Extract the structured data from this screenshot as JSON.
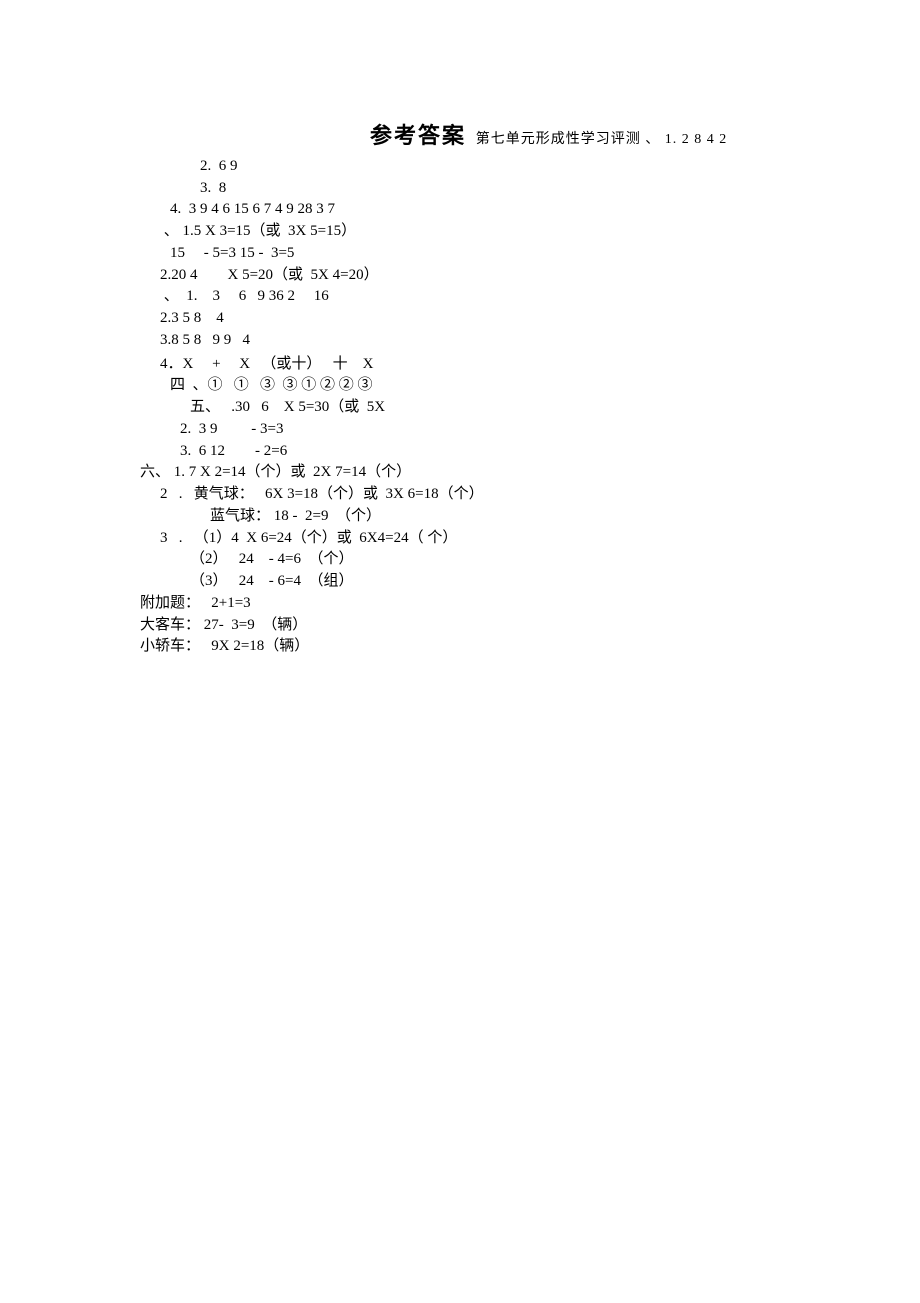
{
  "title": {
    "main": "参考答案",
    "sub": "第七单元形成性学习评测  、   1. 2 8 4 2"
  },
  "lines": {
    "l01": "2.  6 9",
    "l02": "3.  8",
    "l03": "4.  3 9 4 6 15 6 7 4 9 28 3 7",
    "l04": " 、 1.5 X 3=15（或  3X 5=15）",
    "l05": "15     - 5=3 15 -  3=5",
    "l06": "2.20 4        X 5=20（或  5X 4=20）",
    "l07": " 、  1.    3     6   9 36 2     16",
    "l08": "2.3 5 8    4",
    "l09": "3.8 5 8   9 9   4",
    "l10": "4．X     +     X   （或十）   十    X",
    "l11": "四  、①   ①   ③  ③ ① ② ② ③",
    "l12": "五、   .30   6    X 5=30（或  5X",
    "l13": "2.  3 9         - 3=3",
    "l14": "3.  6 12        - 2=6",
    "l15": "六、 1. 7 X 2=14（个）或  2X 7=14（个）",
    "l16": "2   .   黄气球：   6X 3=18（个）或  3X 6=18（个）",
    "l17": "蓝气球： 18 -  2=9  （个）",
    "l18": "3   .   （1）4  X 6=24（个）或  6X4=24（ 个）",
    "l19": "（2）   24    - 4=6  （个）",
    "l20": "（3）   24    - 6=4  （组）",
    "l21": "附加题：   2+1=3",
    "l22": "大客车： 27-  3=9  （辆）",
    "l23": "小轿车：   9X 2=18（辆）"
  }
}
